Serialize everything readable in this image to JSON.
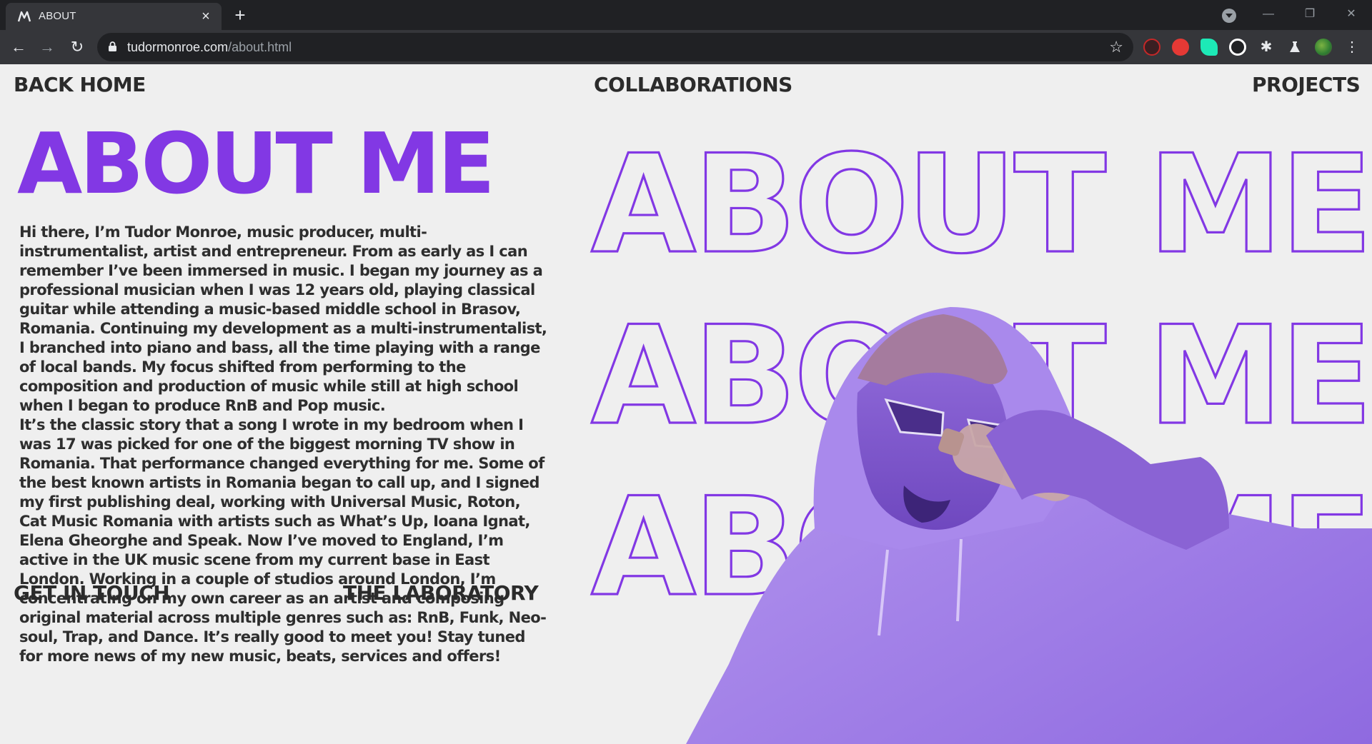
{
  "browser": {
    "tab_title": "ABOUT",
    "tab_close": "×",
    "new_tab": "+",
    "url_domain": "tudormonroe.com",
    "url_path": "/about.html",
    "icons": [
      "site-logo-icon",
      "close-icon",
      "plus-icon",
      "tab-search-icon",
      "minimize-icon",
      "restore-icon",
      "close-window-icon",
      "back-icon",
      "forward-icon",
      "reload-icon",
      "lock-icon",
      "star-icon",
      "puzzle-icon",
      "flask-icon",
      "profile-avatar-icon",
      "menu-icon"
    ]
  },
  "nav": {
    "back_home": "BACK HOME",
    "collaborations": "COLLABORATIONS",
    "projects": "PROJECTS",
    "get_in_touch": "GET IN TOUCH",
    "laboratory": "THE LABORATORY"
  },
  "heading": "ABOUT ME",
  "outline_text": "ABOUT ME",
  "bio": {
    "p1": "Hi there, I’m Tudor Monroe, music producer, multi-instrumentalist, artist and entrepreneur. From as early as I can remember I’ve been immersed in music. I began my journey as a professional musician when I was 12 years old, playing classical guitar while attending a music-based middle school in Brasov, Romania. Continuing my development as a multi-instrumentalist, I branched into piano and bass, all the time playing with a range of local bands. My focus shifted from performing to the composition and production of music while still at high school when I began to produce RnB and Pop music.",
    "p2": "It’s the classic story that a song I wrote in my bedroom when I was 17 was picked for one of the biggest morning TV show in Romania. That performance changed everything for me. Some of the best known artists in Romania began to call up, and I signed my first publishing deal, working with Universal Music, Roton, Cat Music Romania with artists such as What’s Up, Ioana Ignat, Elena Gheorghe and Speak.  Now I’ve moved to England, I’m active in the UK music scene from my current base in East London. Working in a couple of studios around London, I’m concentrating on my own career as an artist and composing original material across multiple genres such as: RnB, Funk, Neo-soul, Trap, and Dance. It’s really good to meet you! Stay tuned for more news of my new music, beats, services and offers!"
  },
  "colors": {
    "accent": "#8238e4",
    "text": "#2e2e2e",
    "page_bg": "#efefef",
    "chrome_dark": "#202124",
    "chrome_mid": "#35363a"
  }
}
